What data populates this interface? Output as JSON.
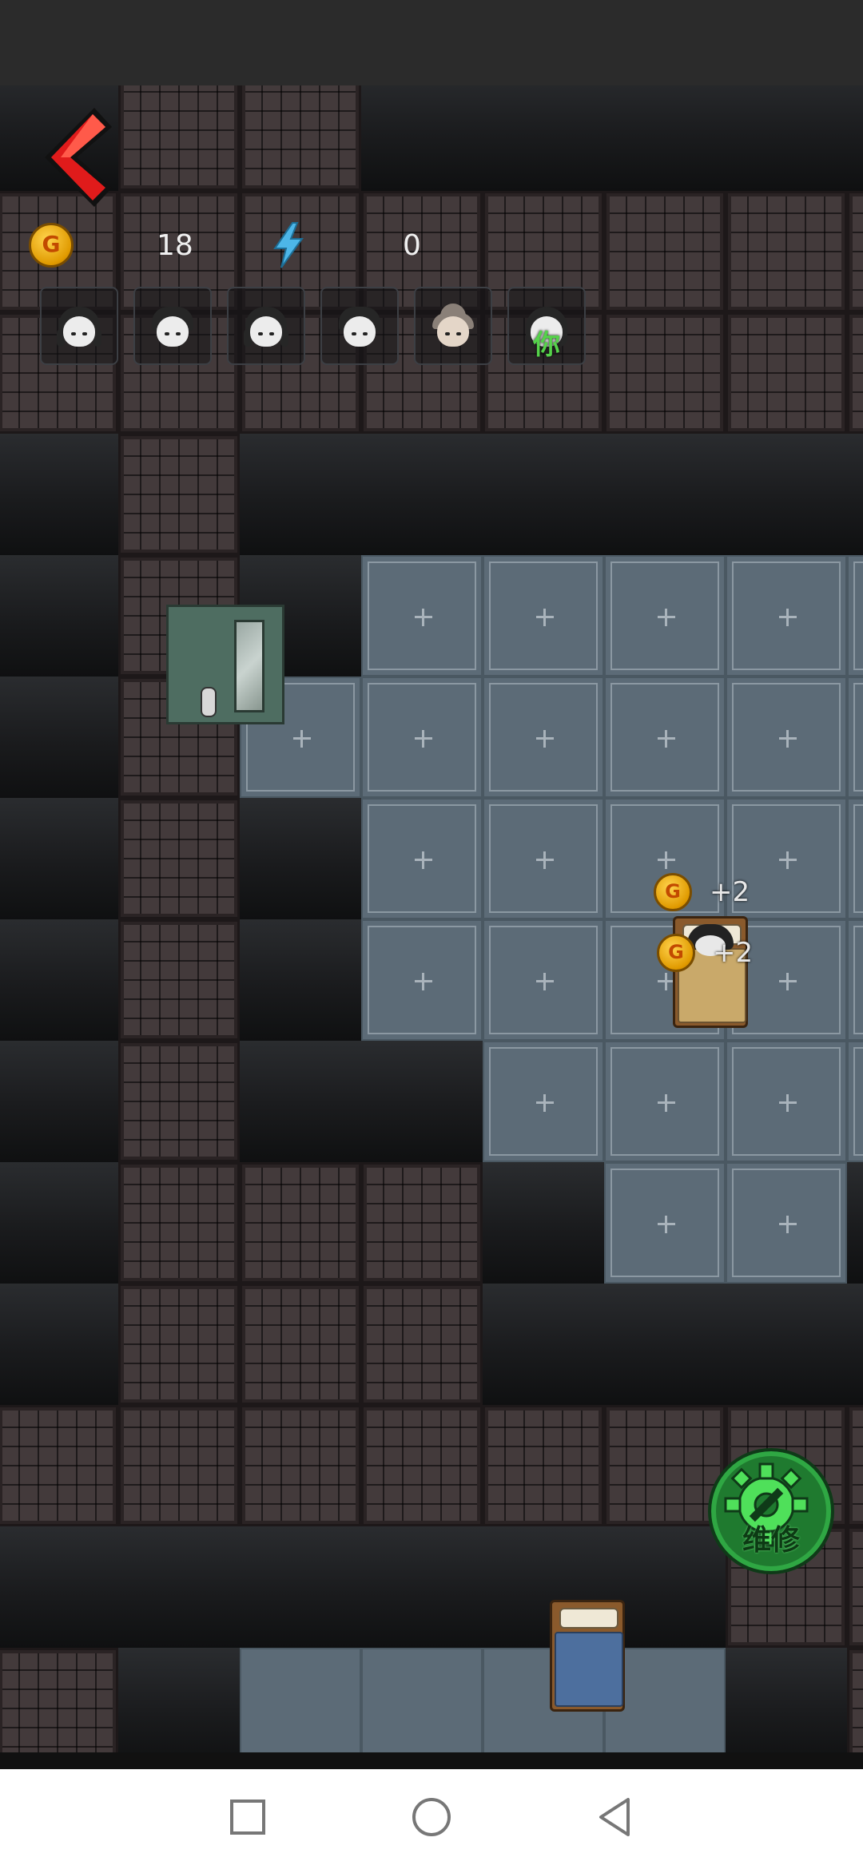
{
  "hud": {
    "coin_icon": "G",
    "coins": "18",
    "energy_icon": "lightning-icon",
    "energy": "0"
  },
  "characters": [
    {
      "type": "girl-braids"
    },
    {
      "type": "boy-messy-hair"
    },
    {
      "type": "girl-braids"
    },
    {
      "type": "boy-messy-hair"
    },
    {
      "type": "old-woman-bun"
    },
    {
      "type": "ghost-girl",
      "label": "你"
    }
  ],
  "rewards": [
    {
      "coin": "G",
      "text": "+2"
    },
    {
      "coin": "G",
      "text": "+2"
    }
  ],
  "repair": {
    "label": "维修"
  },
  "colors": {
    "brick": "#433a3b",
    "floor": "#5c6b77",
    "repair_green": "#1f7a2f",
    "back_red": "#e01b1b"
  },
  "icons": {
    "back": "back-chevron-icon",
    "repair": "gear-wrench-icon",
    "nav_recent": "square-icon",
    "nav_home": "circle-icon",
    "nav_back": "triangle-back-icon"
  }
}
